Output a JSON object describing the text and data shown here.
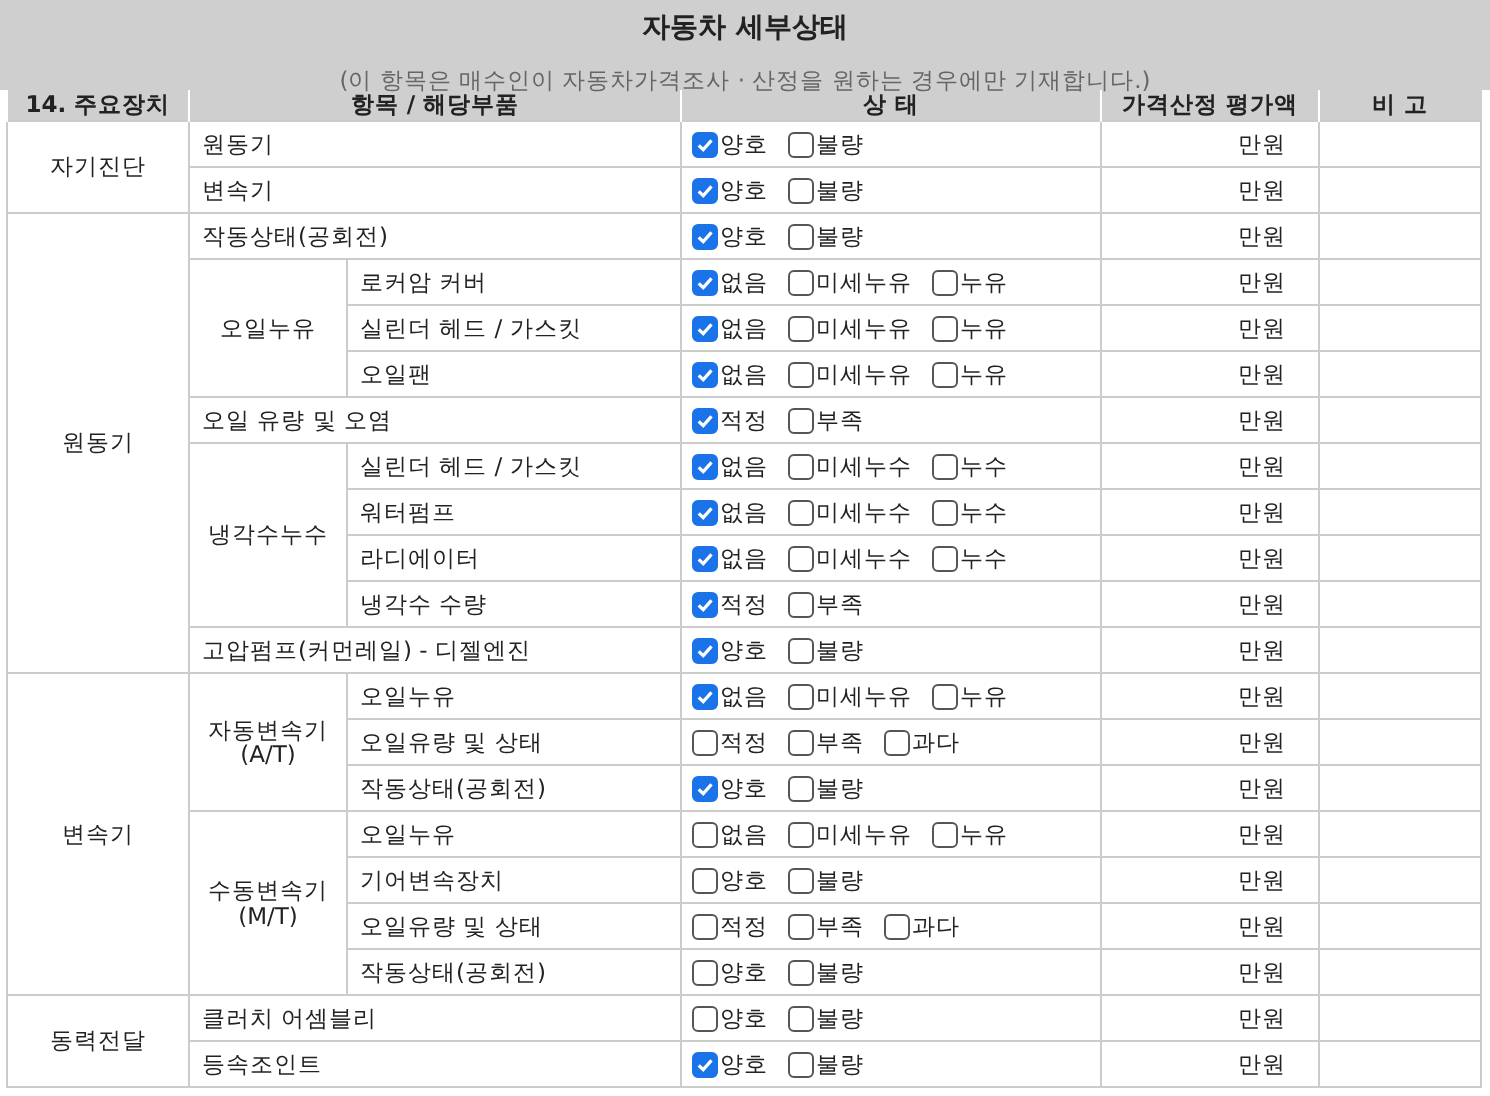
{
  "title": "자동차 세부상태",
  "subtitle": "(이 항목은 매수인이 자동차가격조사 · 산정을 원하는 경우에만 기재합니다.)",
  "columns": [
    "14. 주요장치",
    "항목 / 해당부품",
    "상 태",
    "가격산정 평가액",
    "비 고"
  ],
  "sections": [
    {
      "label": "자기진단",
      "rows": [
        {
          "item": "원동기",
          "price": "만원",
          "options": [
            {
              "label": "양호",
              "checked": true
            },
            {
              "label": "불량",
              "checked": false
            }
          ]
        },
        {
          "item": "변속기",
          "price": "만원",
          "options": [
            {
              "label": "양호",
              "checked": true
            },
            {
              "label": "불량",
              "checked": false
            }
          ]
        }
      ]
    },
    {
      "label": "원동기",
      "rows": [
        {
          "item": "작동상태(공회전)",
          "price": "만원",
          "options": [
            {
              "label": "양호",
              "checked": true
            },
            {
              "label": "불량",
              "checked": false
            }
          ]
        },
        {
          "group": "오일누유",
          "children": [
            {
              "item": "로커암 커버",
              "price": "만원",
              "options": [
                {
                  "label": "없음",
                  "checked": true
                },
                {
                  "label": "미세누유",
                  "checked": false
                },
                {
                  "label": "누유",
                  "checked": false
                }
              ]
            },
            {
              "item": "실린더 헤드 / 가스킷",
              "price": "만원",
              "options": [
                {
                  "label": "없음",
                  "checked": true
                },
                {
                  "label": "미세누유",
                  "checked": false
                },
                {
                  "label": "누유",
                  "checked": false
                }
              ]
            },
            {
              "item": "오일팬",
              "price": "만원",
              "options": [
                {
                  "label": "없음",
                  "checked": true
                },
                {
                  "label": "미세누유",
                  "checked": false
                },
                {
                  "label": "누유",
                  "checked": false
                }
              ]
            }
          ]
        },
        {
          "item": "오일 유량 및 오염",
          "price": "만원",
          "options": [
            {
              "label": "적정",
              "checked": true
            },
            {
              "label": "부족",
              "checked": false
            }
          ]
        },
        {
          "group": "냉각수누수",
          "children": [
            {
              "item": "실린더 헤드 / 가스킷",
              "price": "만원",
              "options": [
                {
                  "label": "없음",
                  "checked": true
                },
                {
                  "label": "미세누수",
                  "checked": false
                },
                {
                  "label": "누수",
                  "checked": false
                }
              ]
            },
            {
              "item": "워터펌프",
              "price": "만원",
              "options": [
                {
                  "label": "없음",
                  "checked": true
                },
                {
                  "label": "미세누수",
                  "checked": false
                },
                {
                  "label": "누수",
                  "checked": false
                }
              ]
            },
            {
              "item": "라디에이터",
              "price": "만원",
              "options": [
                {
                  "label": "없음",
                  "checked": true
                },
                {
                  "label": "미세누수",
                  "checked": false
                },
                {
                  "label": "누수",
                  "checked": false
                }
              ]
            },
            {
              "item": "냉각수 수량",
              "price": "만원",
              "options": [
                {
                  "label": "적정",
                  "checked": true
                },
                {
                  "label": "부족",
                  "checked": false
                }
              ]
            }
          ]
        },
        {
          "item": "고압펌프(커먼레일) - 디젤엔진",
          "price": "만원",
          "options": [
            {
              "label": "양호",
              "checked": true
            },
            {
              "label": "불량",
              "checked": false
            }
          ]
        }
      ]
    },
    {
      "label": "변속기",
      "rows": [
        {
          "group": "자동변속기 (A/T)",
          "children": [
            {
              "item": "오일누유",
              "price": "만원",
              "options": [
                {
                  "label": "없음",
                  "checked": true
                },
                {
                  "label": "미세누유",
                  "checked": false
                },
                {
                  "label": "누유",
                  "checked": false
                }
              ]
            },
            {
              "item": "오일유량 및 상태",
              "price": "만원",
              "options": [
                {
                  "label": "적정",
                  "checked": false
                },
                {
                  "label": "부족",
                  "checked": false
                },
                {
                  "label": "과다",
                  "checked": false
                }
              ]
            },
            {
              "item": "작동상태(공회전)",
              "price": "만원",
              "options": [
                {
                  "label": "양호",
                  "checked": true
                },
                {
                  "label": "불량",
                  "checked": false
                }
              ]
            }
          ]
        },
        {
          "group": "수동변속기 (M/T)",
          "children": [
            {
              "item": "오일누유",
              "price": "만원",
              "options": [
                {
                  "label": "없음",
                  "checked": false
                },
                {
                  "label": "미세누유",
                  "checked": false
                },
                {
                  "label": "누유",
                  "checked": false
                }
              ]
            },
            {
              "item": "기어변속장치",
              "price": "만원",
              "options": [
                {
                  "label": "양호",
                  "checked": false
                },
                {
                  "label": "불량",
                  "checked": false
                }
              ]
            },
            {
              "item": "오일유량 및 상태",
              "price": "만원",
              "options": [
                {
                  "label": "적정",
                  "checked": false
                },
                {
                  "label": "부족",
                  "checked": false
                },
                {
                  "label": "과다",
                  "checked": false
                }
              ]
            },
            {
              "item": "작동상태(공회전)",
              "price": "만원",
              "options": [
                {
                  "label": "양호",
                  "checked": false
                },
                {
                  "label": "불량",
                  "checked": false
                }
              ]
            }
          ]
        }
      ]
    },
    {
      "label": "동력전달",
      "rows": [
        {
          "item": "클러치 어셈블리",
          "price": "만원",
          "options": [
            {
              "label": "양호",
              "checked": false
            },
            {
              "label": "불량",
              "checked": false
            }
          ]
        },
        {
          "item": "등속조인트",
          "price": "만원",
          "options": [
            {
              "label": "양호",
              "checked": true
            },
            {
              "label": "불량",
              "checked": false
            }
          ]
        }
      ]
    }
  ]
}
